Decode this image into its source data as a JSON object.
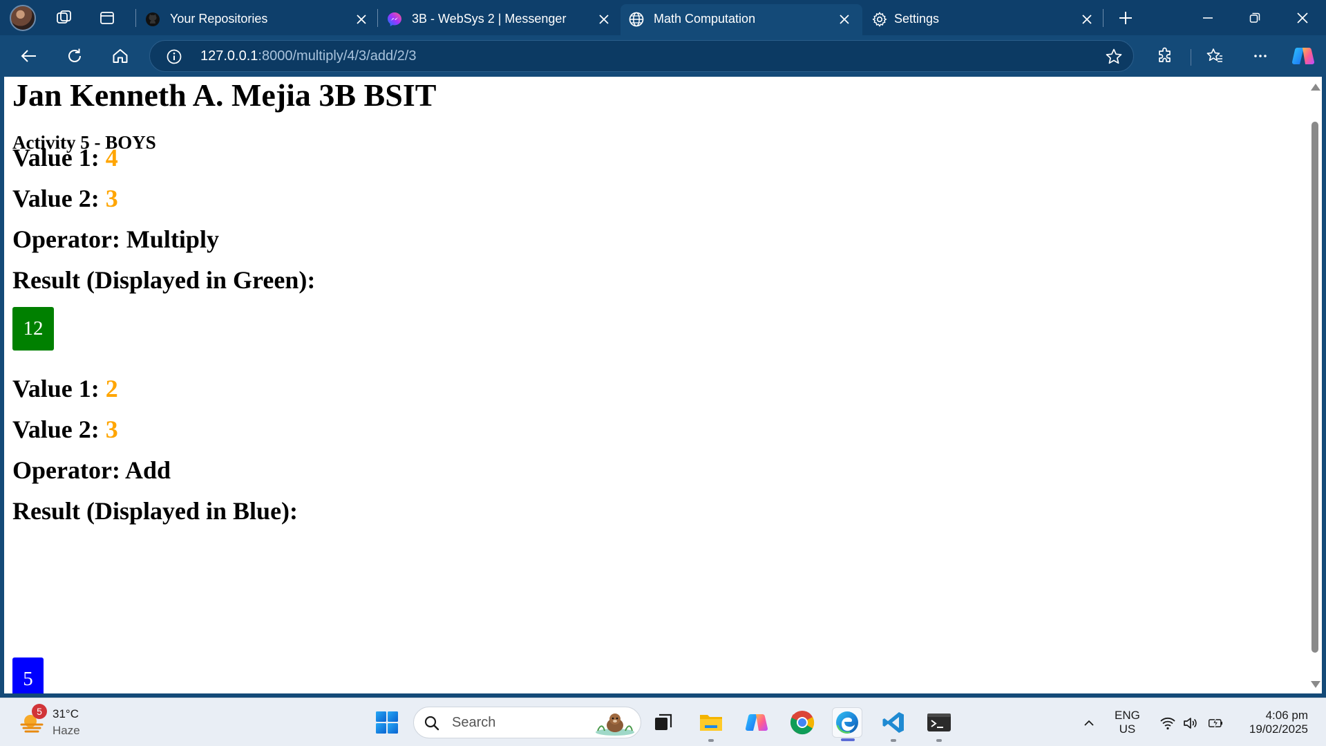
{
  "tabs": [
    {
      "title": "Your Repositories",
      "icon": "github-icon",
      "active": false
    },
    {
      "title": "3B - WebSys 2 | Messenger",
      "icon": "messenger-icon",
      "active": false
    },
    {
      "title": "Math Computation",
      "icon": "globe-icon",
      "active": true
    },
    {
      "title": "Settings",
      "icon": "gear-icon",
      "active": false
    }
  ],
  "address": {
    "host": "127.0.0.1",
    "path": ":8000/multiply/4/3/add/2/3"
  },
  "page": {
    "heading": "Jan Kenneth A. Mejia 3B BSIT",
    "subheading": "Activity 5 - BOYS",
    "computations": [
      {
        "value1_label": "Value 1:",
        "value1": "4",
        "value2_label": "Value 2:",
        "value2": "3",
        "operator_text": "Operator: Multiply",
        "result_label": "Result (Displayed in Green):",
        "result": "12",
        "result_color": "#008000"
      },
      {
        "value1_label": "Value 1:",
        "value1": "2",
        "value2_label": "Value 2:",
        "value2": "3",
        "operator_text": "Operator: Add",
        "result_label": "Result (Displayed in Blue):",
        "result": "5",
        "result_color": "#0000ff"
      }
    ],
    "value_color": "#ffa500"
  },
  "taskbar": {
    "weather": {
      "badge": "5",
      "temp": "31°C",
      "desc": "Haze"
    },
    "search_label": "Search",
    "lang_top": "ENG",
    "lang_bottom": "US",
    "time": "4:06 pm",
    "date": "19/02/2025"
  },
  "colors": {
    "titlebar": "#0e3f6b",
    "toolbar": "#144a78",
    "taskbar": "#e9eef5"
  }
}
